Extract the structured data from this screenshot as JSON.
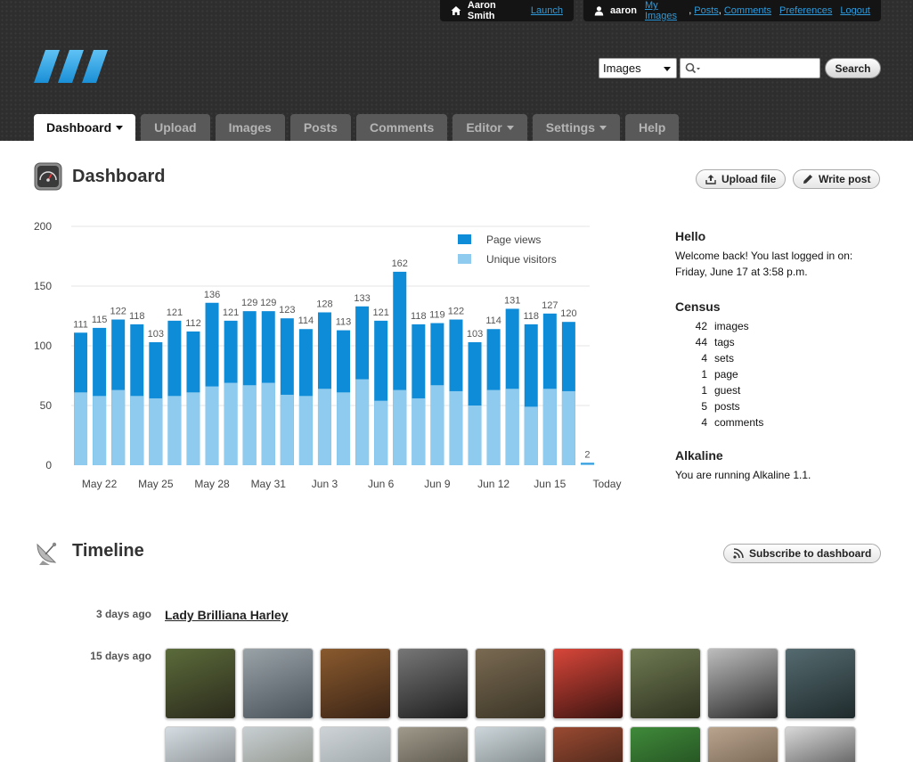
{
  "userbar": {
    "site_user": "Aaron Smith",
    "launch_label": "Launch",
    "username": "aaron",
    "my_images": "My Images",
    "posts": "Posts",
    "comments": "Comments",
    "preferences": "Preferences",
    "logout": "Logout"
  },
  "search": {
    "scope": "Images",
    "query": "",
    "button": "Search"
  },
  "tabs": [
    {
      "label": "Dashboard"
    },
    {
      "label": "Upload"
    },
    {
      "label": "Images"
    },
    {
      "label": "Posts"
    },
    {
      "label": "Comments"
    },
    {
      "label": "Editor"
    },
    {
      "label": "Settings"
    },
    {
      "label": "Help"
    }
  ],
  "dashboard": {
    "title": "Dashboard",
    "upload_button": "Upload file",
    "write_button": "Write post"
  },
  "chart_data": {
    "type": "bar",
    "stacked": true,
    "ylim": [
      0,
      200
    ],
    "yticks": [
      0,
      50,
      100,
      150,
      200
    ],
    "x_tick_labels": [
      "May 22",
      "May 25",
      "May 28",
      "May 31",
      "Jun 3",
      "Jun 6",
      "Jun 9",
      "Jun 12",
      "Jun 15",
      "Today"
    ],
    "series": [
      {
        "name": "Page views",
        "color": "#0f8cd8",
        "values": [
          111,
          115,
          122,
          118,
          103,
          121,
          112,
          136,
          121,
          129,
          129,
          123,
          114,
          128,
          113,
          133,
          121,
          162,
          118,
          119,
          122,
          103,
          114,
          131,
          118,
          127,
          120,
          2
        ]
      },
      {
        "name": "Unique visitors",
        "color": "#8ecbee",
        "values": [
          61,
          58,
          63,
          58,
          56,
          58,
          61,
          66,
          69,
          67,
          69,
          59,
          58,
          64,
          61,
          72,
          54,
          63,
          56,
          67,
          62,
          50,
          63,
          64,
          49,
          64,
          62,
          1
        ]
      }
    ],
    "data_labels": [
      "111",
      "115",
      "122",
      "118",
      "103",
      "121",
      "112",
      "136",
      "121",
      "129",
      "129",
      "123",
      "114",
      "128",
      "113",
      "133",
      "121",
      "162",
      "118",
      "119",
      "122",
      "103",
      "114",
      "131",
      "118",
      "127",
      "120",
      "2"
    ],
    "legend_position": "top-right",
    "grid": true
  },
  "sidebar": {
    "hello_title": "Hello",
    "hello_text_1": "Welcome back! You last logged in on:",
    "hello_text_2": "Friday, June 17 at 3:58 p.m.",
    "census_title": "Census",
    "census": [
      {
        "count": "42",
        "label": "images"
      },
      {
        "count": "44",
        "label": "tags"
      },
      {
        "count": "4",
        "label": "sets"
      },
      {
        "count": "1",
        "label": "page"
      },
      {
        "count": "1",
        "label": "guest"
      },
      {
        "count": "5",
        "label": "posts"
      },
      {
        "count": "4",
        "label": "comments"
      }
    ],
    "alkaline_title": "Alkaline",
    "alkaline_text": "You are running Alkaline 1.1."
  },
  "timeline": {
    "title": "Timeline",
    "subscribe_button": "Subscribe to dashboard",
    "entries": [
      {
        "date": "3 days ago",
        "post_title": "Lady Brilliana Harley"
      },
      {
        "date": "15 days ago"
      }
    ]
  },
  "colors": {
    "accent_blue": "#0f8cd8",
    "light_blue": "#8ecbee",
    "link_blue": "#2f9bdc",
    "header_bg": "#2e2e2e"
  }
}
